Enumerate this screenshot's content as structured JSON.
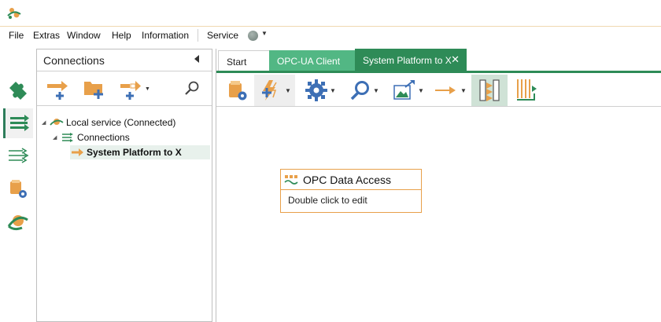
{
  "menu": {
    "items": [
      "File",
      "Extras",
      "Window",
      "Help",
      "Information"
    ],
    "service_label": "Service"
  },
  "panel": {
    "title": "Connections",
    "tree": {
      "root": "Local service (Connected)",
      "group": "Connections",
      "leaf": "System Platform to X"
    }
  },
  "editor": {
    "tabs": [
      "Start",
      "OPC-UA Client",
      "System Platform to X"
    ],
    "block": {
      "title": "OPC Data Access",
      "hint": "Double click to edit"
    }
  },
  "colors": {
    "accent": "#2e8b57",
    "accent_light": "#52b784",
    "orange": "#e8a04a"
  }
}
